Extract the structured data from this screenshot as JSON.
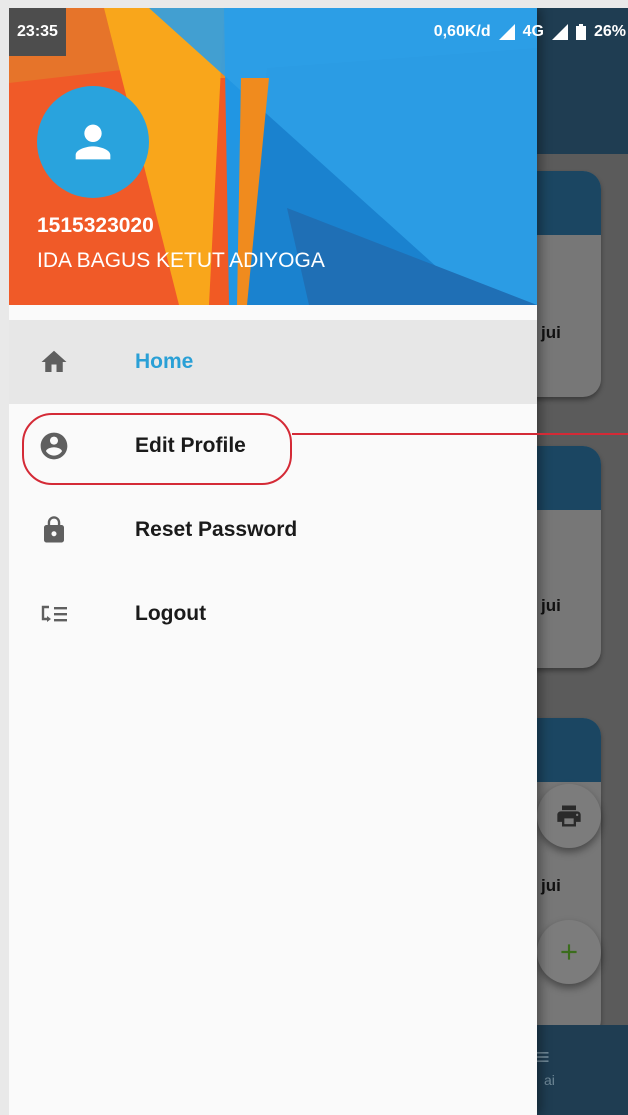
{
  "status_bar": {
    "time": "23:35",
    "speed": "0,60K/d",
    "network": "4G",
    "battery": "26%"
  },
  "drawer": {
    "user_id": "1515323020",
    "user_name": "IDA BAGUS KETUT ADIYOGA",
    "menu": [
      {
        "label": "Home",
        "icon": "home-icon",
        "active": true
      },
      {
        "label": "Edit Profile",
        "icon": "account-circle-icon",
        "active": false
      },
      {
        "label": "Reset Password",
        "icon": "lock-icon",
        "active": false
      },
      {
        "label": "Logout",
        "icon": "logout-icon",
        "active": false
      }
    ]
  },
  "background": {
    "card_1_text": "jui",
    "card_2_text": "jui",
    "card_3_text": "jui",
    "bottom_label": "ai"
  },
  "colors": {
    "accent": "#2aa0d6",
    "header_orange": "#f05a28",
    "header_blue": "#1e88d3",
    "callout": "#d42a36"
  }
}
